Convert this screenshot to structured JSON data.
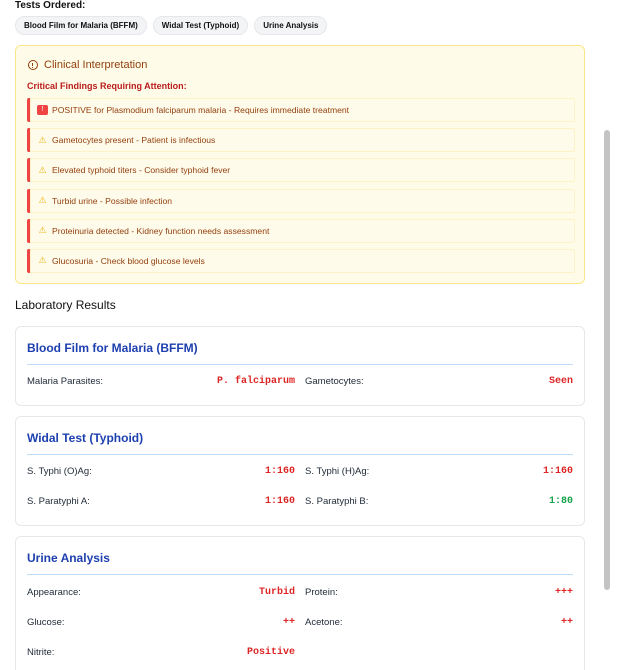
{
  "tests_ordered": {
    "label": "Tests Ordered:",
    "chips": [
      "Blood Film for Malaria (BFFM)",
      "Widal Test (Typhoid)",
      "Urine Analysis"
    ]
  },
  "clinical_interpretation": {
    "title": "Clinical Interpretation",
    "critical_label": "Critical Findings Requiring Attention:",
    "findings": [
      {
        "icon": "red-alert-icon",
        "glyph": "!",
        "text": "POSITIVE for Plasmodium falciparum malaria - Requires immediate treatment"
      },
      {
        "icon": "warning-icon",
        "glyph": "⚠",
        "text": "Gametocytes present - Patient is infectious"
      },
      {
        "icon": "warning-icon",
        "glyph": "⚠",
        "text": "Elevated typhoid titers - Consider typhoid fever"
      },
      {
        "icon": "warning-icon",
        "glyph": "⚠",
        "text": "Turbid urine - Possible infection"
      },
      {
        "icon": "warning-icon",
        "glyph": "⚠",
        "text": "Proteinuria detected - Kidney function needs assessment"
      },
      {
        "icon": "warning-icon",
        "glyph": "⚠",
        "text": "Glucosuria - Check blood glucose levels"
      }
    ]
  },
  "lab_results": {
    "heading": "Laboratory Results",
    "bffm": {
      "title": "Blood Film for Malaria (BFFM)",
      "rows": [
        {
          "left_label": "Malaria Parasites:",
          "left_value": "P. falciparum",
          "right_label": "Gametocytes:",
          "right_value": "Seen"
        }
      ]
    },
    "widal": {
      "title": "Widal Test (Typhoid)",
      "rows": [
        {
          "left_label": "S. Typhi (O)Ag:",
          "left_value": "1:160",
          "right_label": "S. Typhi (H)Ag:",
          "right_value": "1:160"
        },
        {
          "left_label": "S. Paratyphi A:",
          "left_value": "1:160",
          "right_label": "S. Paratyphi B:",
          "right_value": "1:80"
        }
      ]
    },
    "urine": {
      "title": "Urine Analysis",
      "rows": [
        {
          "left_label": "Appearance:",
          "left_value": "Turbid",
          "right_label": "Protein:",
          "right_value": "+++"
        },
        {
          "left_label": "Glucose:",
          "left_value": "++",
          "right_label": "Acetone:",
          "right_value": "++"
        },
        {
          "left_label": "Nitrite:",
          "left_value": "Positive"
        }
      ]
    }
  },
  "colors": {
    "critical": "#dc2626",
    "normal": "#16a34a",
    "accent": "#1e40af",
    "warning_bg": "#fefce8"
  }
}
